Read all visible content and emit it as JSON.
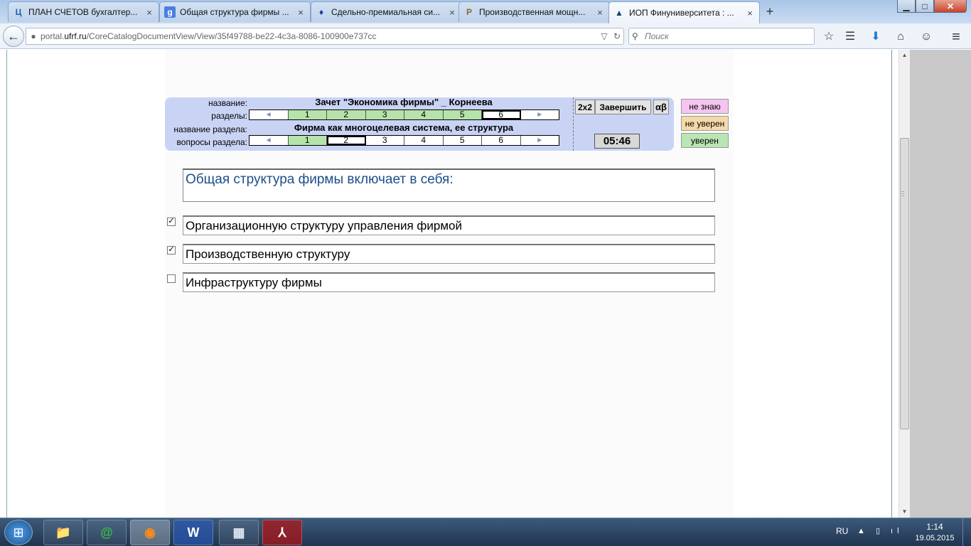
{
  "browser": {
    "tabs": [
      {
        "icon": "Ц",
        "title": "ПЛАН СЧЕТОВ бухгалтер...",
        "close": "×"
      },
      {
        "icon": "g",
        "title": "Общая структура фирмы ...",
        "close": "×"
      },
      {
        "icon": "♦",
        "title": "Сдельно-премиальная си...",
        "close": "×"
      },
      {
        "icon": "P",
        "title": "Производственная мощн...",
        "close": "×"
      },
      {
        "icon": "▲",
        "title": "ИОП Финуниверситета : ...",
        "close": "×"
      }
    ],
    "new_tab": "+",
    "window": {
      "minimize": "▁",
      "maximize": "□",
      "close": "✕"
    },
    "back": "←",
    "url": {
      "prefix": "portal.",
      "domain": "ufrf.ru",
      "path": "/CoreCatalogDocumentView/View/35f49788-be22-4c3a-8086-100900e737cc"
    },
    "url_dropdown": "▽",
    "reload": "↻",
    "search_placeholder": "Поиск",
    "toolbar_icons": {
      "bookmark": "☆",
      "reading_list": "☰",
      "download": "⬇",
      "home": "⌂",
      "chat": "☺",
      "menu": "≡"
    }
  },
  "test": {
    "labels": {
      "title": "название:",
      "sections": "разделы:",
      "section_title": "название раздела:",
      "section_questions": "вопросы раздела:"
    },
    "title": "Зачет \"Экономика фирмы\" _ Корнеева",
    "section_title": "Фирма как многоцелевая система, ее структура",
    "arrow_left": "◄",
    "arrow_right": "►",
    "sections": [
      {
        "label": "1",
        "state": "done"
      },
      {
        "label": "2",
        "state": "done"
      },
      {
        "label": "3",
        "state": "done"
      },
      {
        "label": "4",
        "state": "done"
      },
      {
        "label": "5",
        "state": "done"
      },
      {
        "label": "6",
        "state": "current"
      }
    ],
    "questions": [
      {
        "label": "1",
        "state": "done"
      },
      {
        "label": "2",
        "state": "current"
      },
      {
        "label": "3",
        "state": "none"
      },
      {
        "label": "4",
        "state": "none"
      },
      {
        "label": "5",
        "state": "none"
      },
      {
        "label": "6",
        "state": "none"
      }
    ],
    "buttons": {
      "two_by_two": "2x2",
      "finish": "Завершить",
      "alpha_beta": "αβ"
    },
    "timer": "05:46",
    "confidence": {
      "dont_know": "не знаю",
      "not_sure": "не уверен",
      "sure": "уверен"
    },
    "question": "Общая структура фирмы включает в себя:",
    "answers": [
      {
        "text": "Организационную структуру управления фирмой",
        "checked": true
      },
      {
        "text": "Производственную структуру",
        "checked": true
      },
      {
        "text": "Инфраструктуру фирмы",
        "checked": false
      }
    ],
    "check_mark": "✓"
  },
  "taskbar": {
    "start": "⊞",
    "apps": [
      "📁",
      "@",
      "◉",
      "W",
      "▦",
      "⅄"
    ],
    "lang": "RU",
    "tray": "▲ ▯ ıl",
    "time": "1:14",
    "date": "19.05.2015"
  },
  "colors": {
    "done_cell": "#b5e3a9",
    "header_bg": "#c9d4f5",
    "question_text": "#1b4e8a"
  }
}
